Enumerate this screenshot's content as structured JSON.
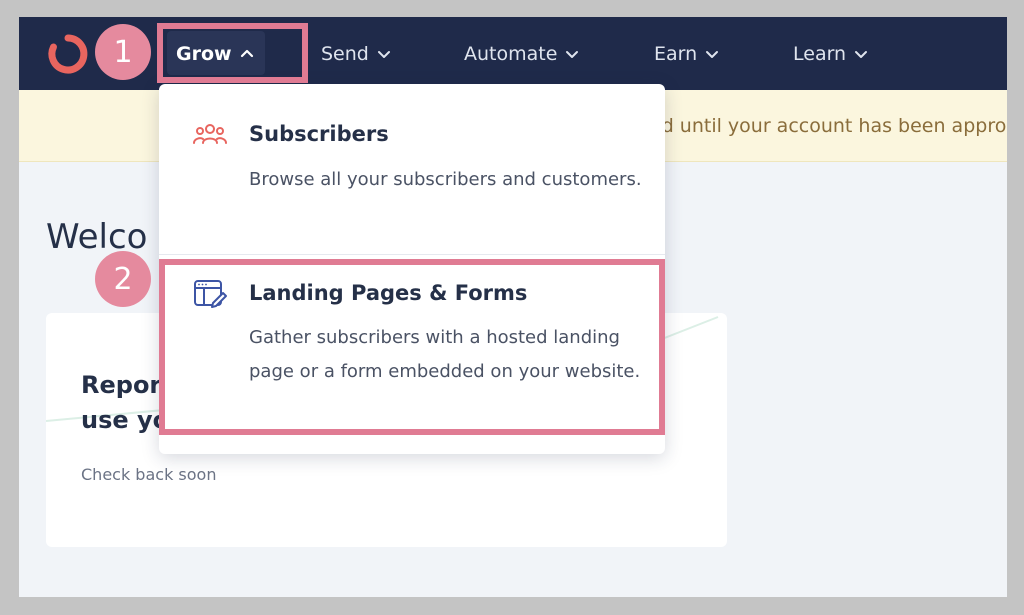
{
  "nav": {
    "items": [
      {
        "label": "Grow",
        "active": true
      },
      {
        "label": "Send",
        "active": false
      },
      {
        "label": "Automate",
        "active": false
      },
      {
        "label": "Earn",
        "active": false
      },
      {
        "label": "Learn",
        "active": false
      }
    ]
  },
  "banner": {
    "text": "ed until your account has been appro"
  },
  "main": {
    "welcome": "Welco",
    "card": {
      "title": "Report\nuse yo",
      "subtitle": "Check back soon"
    }
  },
  "dropdown": {
    "items": [
      {
        "title": "Subscribers",
        "description": "Browse all your subscribers and customers.",
        "icon": "users-icon"
      },
      {
        "title": "Landing Pages & Forms",
        "description": "Gather subscribers with a hosted landing page or a form embedded on your website.",
        "icon": "form-edit-icon"
      }
    ]
  },
  "annotations": {
    "step1": "1",
    "step2": "2"
  },
  "colors": {
    "nav_bg": "#1f2a4a",
    "brand": "#e8655f",
    "highlight": "#e07b93",
    "banner_bg": "#fbf6de"
  }
}
